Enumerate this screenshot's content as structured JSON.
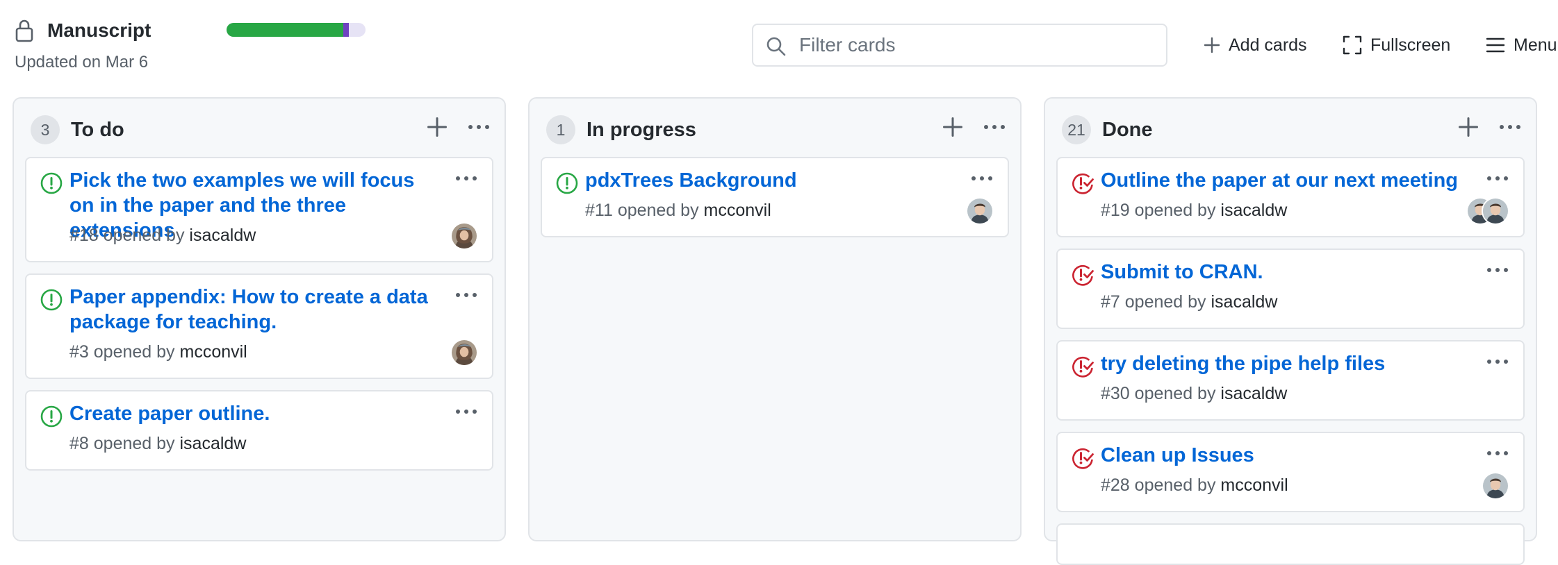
{
  "project": {
    "title": "Manuscript",
    "updated": "Updated on Mar 6",
    "progress": {
      "done_pct": 84,
      "in_progress_pct": 4
    }
  },
  "toolbar": {
    "filter_placeholder": "Filter cards",
    "add_cards_label": "Add cards",
    "fullscreen_label": "Fullscreen",
    "menu_label": "Menu"
  },
  "colors": {
    "link": "#0366d6",
    "open_issue": "#28a745",
    "closed_issue": "#cb2431",
    "progress_done": "#28a745",
    "progress_in_progress": "#6f42c1"
  },
  "columns": [
    {
      "count": "3",
      "title": "To do",
      "cards": [
        {
          "status_icon": "issue-opened-icon",
          "title": "Pick the two examples we will focus on in the paper and the three extensions",
          "number": "#18",
          "opened_by": "opened by",
          "author": "isacaldw"
        },
        {
          "status_icon": "issue-opened-icon",
          "title": "Paper appendix: How to create a data package for teaching.",
          "number": "#3",
          "opened_by": "opened by",
          "author": "mcconvil"
        },
        {
          "status_icon": "issue-opened-icon",
          "title": "Create paper outline.",
          "number": "#8",
          "opened_by": "opened by",
          "author": "isacaldw"
        }
      ]
    },
    {
      "count": "1",
      "title": "In progress",
      "cards": [
        {
          "status_icon": "issue-opened-icon",
          "title": "pdxTrees Background",
          "number": "#11",
          "opened_by": "opened by",
          "author": "mcconvil"
        }
      ]
    },
    {
      "count": "21",
      "title": "Done",
      "cards": [
        {
          "status_icon": "issue-closed-icon",
          "title": "Outline the paper at our next meeting",
          "number": "#19",
          "opened_by": "opened by",
          "author": "isacaldw"
        },
        {
          "status_icon": "issue-closed-icon",
          "title": "Submit to CRAN.",
          "number": "#7",
          "opened_by": "opened by",
          "author": "isacaldw"
        },
        {
          "status_icon": "issue-closed-icon",
          "title": "try deleting the pipe help files",
          "number": "#30",
          "opened_by": "opened by",
          "author": "isacaldw"
        },
        {
          "status_icon": "issue-closed-icon",
          "title": "Clean up Issues",
          "number": "#28",
          "opened_by": "opened by",
          "author": "mcconvil"
        }
      ]
    }
  ]
}
